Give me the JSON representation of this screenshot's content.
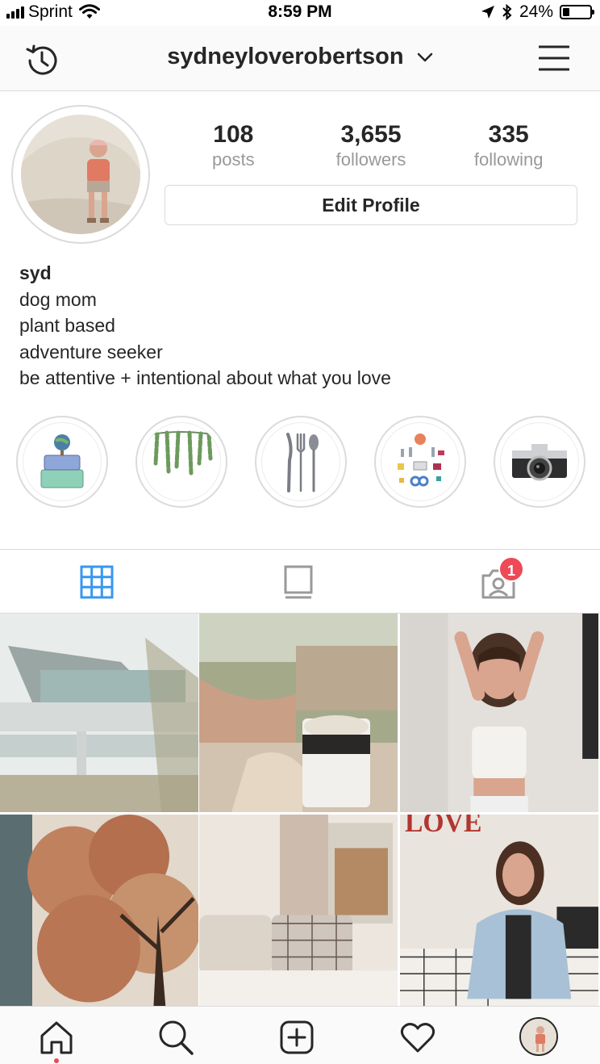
{
  "status_bar": {
    "carrier": "Sprint",
    "time": "8:59 PM",
    "battery_percent": "24%",
    "battery_level": 0.24,
    "icons": [
      "signal-icon",
      "wifi-icon",
      "location-arrow-icon",
      "bluetooth-icon",
      "battery-icon"
    ]
  },
  "header": {
    "username": "sydneyloverobertson",
    "icons": [
      "history-icon",
      "chevron-down-icon",
      "hamburger-menu-icon"
    ]
  },
  "profile": {
    "stats": [
      {
        "value": "108",
        "label": "posts"
      },
      {
        "value": "3,655",
        "label": "followers"
      },
      {
        "value": "335",
        "label": "following"
      }
    ],
    "edit_button": "Edit Profile",
    "bio": {
      "name": "syd",
      "lines": [
        "dog mom",
        "plant based",
        "adventure seeker",
        "be attentive + intentional about what you love"
      ]
    }
  },
  "highlights": [
    "suitcases-globe",
    "hanging-plants",
    "silverware",
    "climbing-gear",
    "camera"
  ],
  "tabs": {
    "items": [
      "grid-tab",
      "feed-tab",
      "tagged-tab"
    ],
    "active": "grid-tab",
    "tagged_badge": "1"
  },
  "posts": [
    "modern-building",
    "coffee-mug-garden",
    "girl-white-top",
    "autumn-tree",
    "bed-with-pillows",
    "girl-denim-jacket"
  ],
  "bottom_nav": {
    "items": [
      "home-icon",
      "search-icon",
      "new-post-icon",
      "activity-heart-icon",
      "profile-avatar"
    ],
    "active": "home-icon"
  },
  "colors": {
    "accent_blue": "#3897f0",
    "badge_red": "#ed4956",
    "border": "#dbdbdb",
    "text": "#262626",
    "muted": "#999999"
  }
}
